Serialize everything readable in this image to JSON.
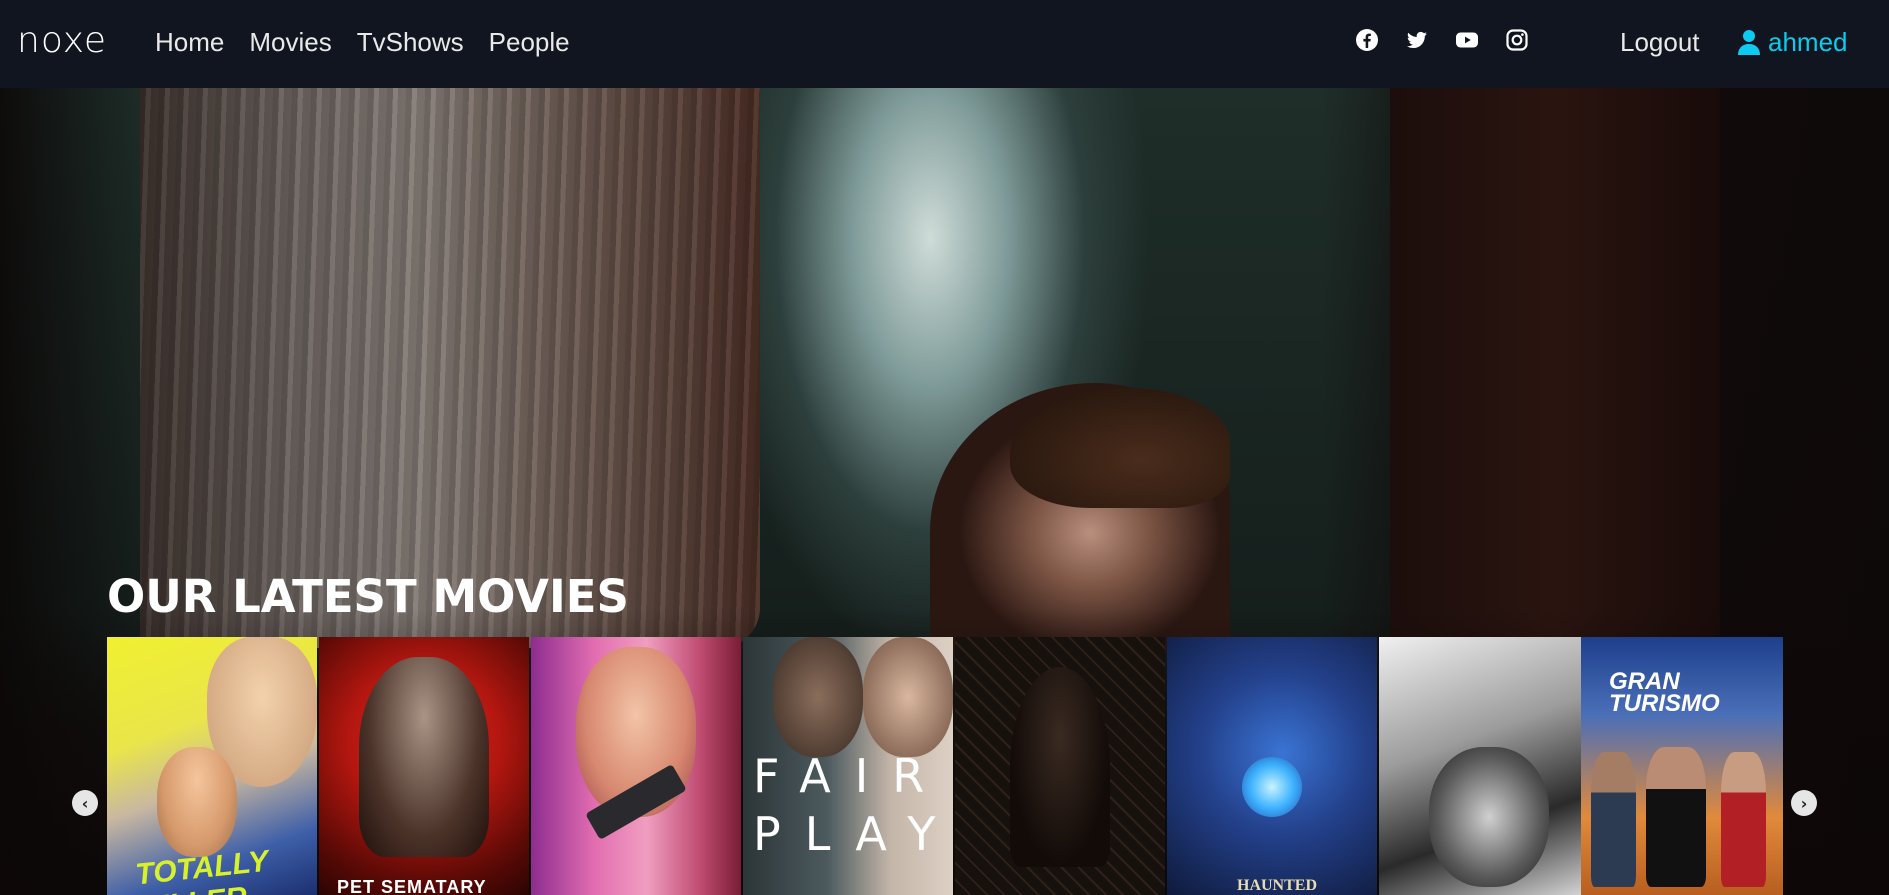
{
  "brand": {
    "logo": "noxe"
  },
  "nav": {
    "links": [
      "Home",
      "Movies",
      "TvShows",
      "People"
    ]
  },
  "socials": [
    "facebook-icon",
    "twitter-icon",
    "youtube-icon",
    "instagram-icon"
  ],
  "account": {
    "logout_label": "Logout",
    "username": "ahmed"
  },
  "hero": {
    "section_title": "OUR LATEST MOVIES"
  },
  "carousel": {
    "prev_glyph": "‹",
    "next_glyph": "›",
    "posters": [
      {
        "title_text": "TOTALLY KILLER"
      },
      {
        "title_text": "PET SEMATARY"
      },
      {
        "title_text": ""
      },
      {
        "title_text": "FAIR PLAY"
      },
      {
        "title_text": ""
      },
      {
        "title_text": "HAUNTED"
      },
      {
        "title_text": ""
      },
      {
        "title_text": "GRAN TURISMO"
      }
    ]
  },
  "colors": {
    "navbar": "#101520",
    "accent": "#0dcaf0",
    "nav_text": "#e9e9e9"
  }
}
